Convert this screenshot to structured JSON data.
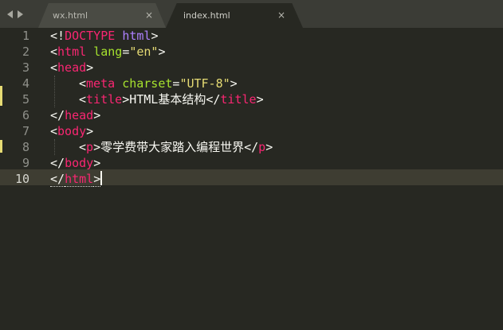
{
  "tabs": [
    {
      "label": "wx.html",
      "active": false
    },
    {
      "label": "index.html",
      "active": true
    }
  ],
  "icons": {
    "back": "chevron-left-icon",
    "forward": "chevron-right-icon",
    "close": "close-icon"
  },
  "close_glyph": "×",
  "colors": {
    "background": "#272822",
    "tag": "#f92672",
    "attribute": "#a6e22e",
    "string": "#e6db74",
    "doctype": "#ae81ff",
    "text": "#f8f8f2"
  },
  "line_numbers": [
    "1",
    "2",
    "3",
    "4",
    "5",
    "6",
    "7",
    "8",
    "9",
    "10"
  ],
  "current_line": "10",
  "code": {
    "l1": {
      "open": "<!",
      "doctype": "DOCTYPE",
      "sp": " ",
      "html": "html",
      "close": ">"
    },
    "l2": {
      "open": "<",
      "tag": "html",
      "sp": " ",
      "attr": "lang",
      "eq": "=",
      "val": "\"en\"",
      "close": ">"
    },
    "l3": {
      "open": "<",
      "tag": "head",
      "close": ">"
    },
    "l4": {
      "open": "<",
      "tag": "meta",
      "sp": " ",
      "attr": "charset",
      "eq": "=",
      "val": "\"UTF-8\"",
      "close": ">"
    },
    "l5": {
      "open": "<",
      "tag": "title",
      "close": ">",
      "text": "HTML基本结构",
      "open2": "</",
      "tag2": "title",
      "close2": ">"
    },
    "l6": {
      "open": "</",
      "tag": "head",
      "close": ">"
    },
    "l7": {
      "open": "<",
      "tag": "body",
      "close": ">"
    },
    "l8": {
      "open": "<",
      "tag": "p",
      "close": ">",
      "text": "零学费带大家踏入编程世界",
      "open2": "</",
      "tag2": "p",
      "close2": ">"
    },
    "l9": {
      "open": "</",
      "tag": "body",
      "close": ">"
    },
    "l10": {
      "open": "</",
      "tag": "html",
      "close": ">"
    }
  }
}
